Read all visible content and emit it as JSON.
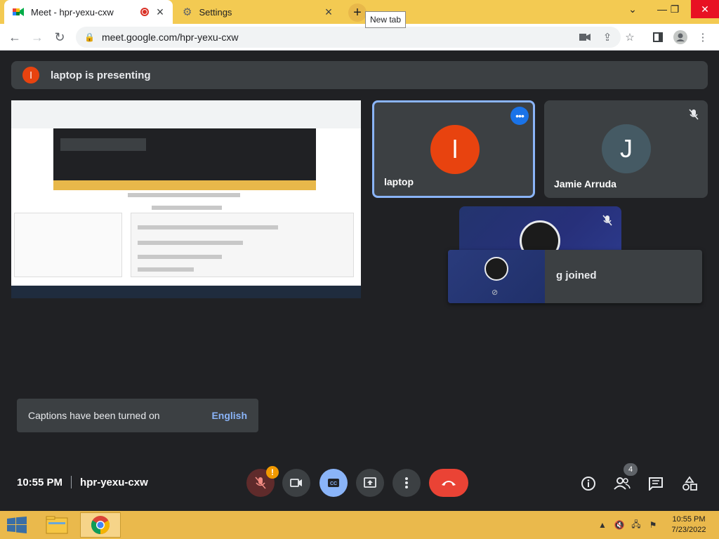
{
  "browser": {
    "tabs": [
      {
        "title": "Meet - hpr-yexu-cxw",
        "active": true
      },
      {
        "title": "Settings",
        "active": false
      }
    ],
    "new_tab_tooltip": "New tab",
    "url": "meet.google.com/hpr-yexu-cxw"
  },
  "meet": {
    "presenting_avatar_letter": "l",
    "presenting_text": "laptop is presenting",
    "tiles": [
      {
        "name": "laptop",
        "avatar_letter": "l",
        "avatar_color": "#e8430f"
      },
      {
        "name": "Jamie Arruda",
        "avatar_letter": "J",
        "avatar_color": "#455a64"
      }
    ],
    "joined_text": "g joined",
    "captions_toast": {
      "message": "Captions have been turned on",
      "language": "English"
    },
    "meeting_time": "10:55 PM",
    "meeting_code": "hpr-yexu-cxw",
    "mic_warning_badge": "!",
    "people_count": "4"
  },
  "taskbar": {
    "clock_time": "10:55 PM",
    "clock_date": "7/23/2022"
  },
  "colors": {
    "tabstrip": "#f3ca52",
    "meet_bg": "#202124",
    "accent_blue": "#8ab4f8",
    "end_call_red": "#ea4335"
  }
}
